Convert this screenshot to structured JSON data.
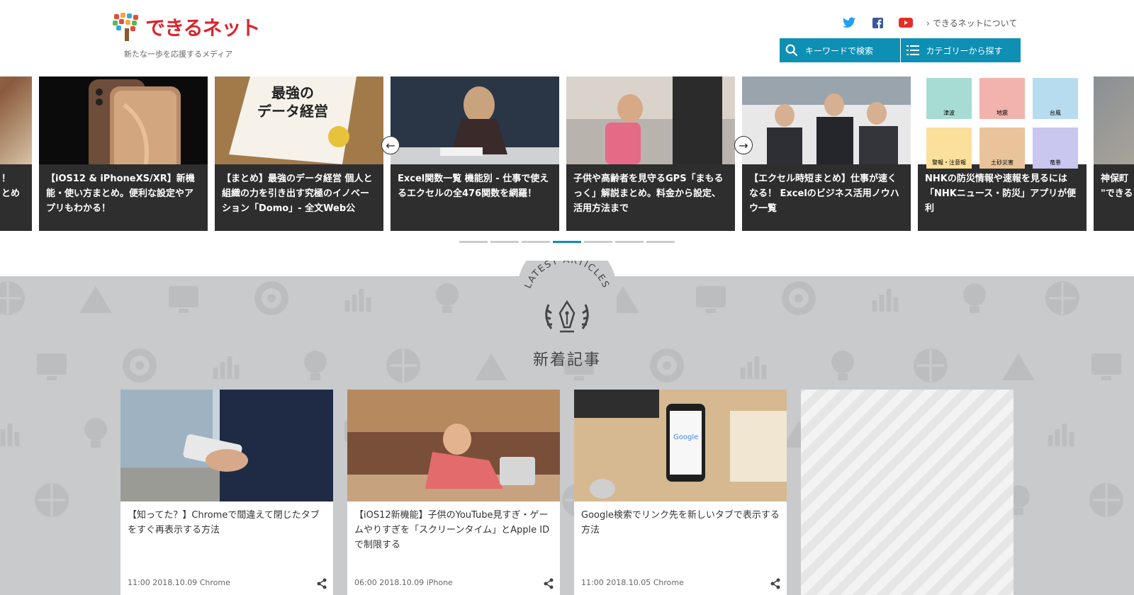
{
  "header": {
    "logo_text": "できるネット",
    "tagline": "新たな一歩を応援するメディア",
    "about_link": "できるネットについて",
    "search_keyword_label": "キーワードで検索",
    "search_category_label": "カテゴリーから探す",
    "social_icons": [
      "twitter-icon",
      "facebook-icon",
      "youtube-icon"
    ]
  },
  "carousel": {
    "slides": [
      {
        "title": "！\nとめ"
      },
      {
        "title": "【iOS12 & iPhoneXS/XR】新機能・使い方まとめ。便利な設定やアプリもわかる！"
      },
      {
        "title": "【まとめ】最強のデータ経営 個人と組織の力を引き出す究極のイノベーション「Domo」- 全文Web公"
      },
      {
        "title": "Excel関数一覧 機能別 - 仕事で使えるエクセルの全476関数を網羅！"
      },
      {
        "title": "子供や高齢者を見守るGPS「まもるっく」解説まとめ。料金から設定、活用方法まで"
      },
      {
        "title": "【エクセル時短まとめ】仕事が速くなる！ Excelのビジネス活用ノウハウ一覧"
      },
      {
        "title": "NHKの防災情報や速報を見るには「NHKニュース・防災」アプリが便利"
      },
      {
        "title": "神保町\n\"できる"
      }
    ],
    "nhk_tiles": [
      "津波",
      "地震",
      "台風",
      "警報・注意報",
      "土砂災害",
      "竜巻"
    ],
    "book_cover_lines": [
      "最強の",
      "データ経営"
    ],
    "active_dot": 3,
    "dot_count": 7
  },
  "latest": {
    "badge_arc_text": "LATEST ARTICLES",
    "title": "新着記事",
    "cards": [
      {
        "title": "【知ってた？】Chromeで間違えて閉じたタブをすぐ再表示する方法",
        "time": "11:00",
        "date": "2018.10.09",
        "category": "Chrome"
      },
      {
        "title": "【iOS12新機能】子供のYouTube見すぎ・ゲームやりすぎを「スクリーンタイム」とApple IDで制限する",
        "time": "06:00",
        "date": "2018.10.09",
        "category": "iPhone"
      },
      {
        "title": "Google検索でリンク先を新しいタブで表示する方法",
        "time": "11:00",
        "date": "2018.10.05",
        "category": "Chrome"
      }
    ]
  },
  "colors": {
    "accent": "#0e8fb4",
    "brand_red": "#d9262e",
    "slide_bg": "#2e2e2e",
    "section_bg": "#c9cacc"
  }
}
